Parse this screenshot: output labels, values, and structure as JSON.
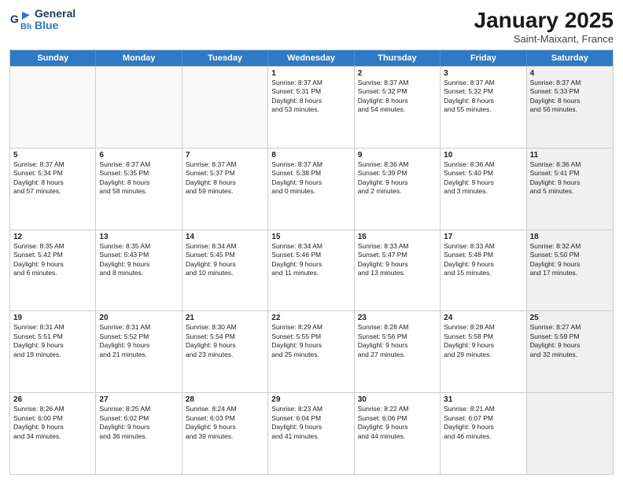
{
  "header": {
    "logo_general": "General",
    "logo_blue": "Blue",
    "month_title": "January 2025",
    "location": "Saint-Maixant, France"
  },
  "weekdays": [
    "Sunday",
    "Monday",
    "Tuesday",
    "Wednesday",
    "Thursday",
    "Friday",
    "Saturday"
  ],
  "rows": [
    [
      {
        "day": "",
        "text": "",
        "empty": true
      },
      {
        "day": "",
        "text": "",
        "empty": true
      },
      {
        "day": "",
        "text": "",
        "empty": true
      },
      {
        "day": "1",
        "text": "Sunrise: 8:37 AM\nSunset: 5:31 PM\nDaylight: 8 hours\nand 53 minutes."
      },
      {
        "day": "2",
        "text": "Sunrise: 8:37 AM\nSunset: 5:32 PM\nDaylight: 8 hours\nand 54 minutes."
      },
      {
        "day": "3",
        "text": "Sunrise: 8:37 AM\nSunset: 5:32 PM\nDaylight: 8 hours\nand 55 minutes."
      },
      {
        "day": "4",
        "text": "Sunrise: 8:37 AM\nSunset: 5:33 PM\nDaylight: 8 hours\nand 56 minutes.",
        "shaded": true
      }
    ],
    [
      {
        "day": "5",
        "text": "Sunrise: 8:37 AM\nSunset: 5:34 PM\nDaylight: 8 hours\nand 57 minutes."
      },
      {
        "day": "6",
        "text": "Sunrise: 8:37 AM\nSunset: 5:35 PM\nDaylight: 8 hours\nand 58 minutes."
      },
      {
        "day": "7",
        "text": "Sunrise: 8:37 AM\nSunset: 5:37 PM\nDaylight: 8 hours\nand 59 minutes."
      },
      {
        "day": "8",
        "text": "Sunrise: 8:37 AM\nSunset: 5:38 PM\nDaylight: 9 hours\nand 0 minutes."
      },
      {
        "day": "9",
        "text": "Sunrise: 8:36 AM\nSunset: 5:39 PM\nDaylight: 9 hours\nand 2 minutes."
      },
      {
        "day": "10",
        "text": "Sunrise: 8:36 AM\nSunset: 5:40 PM\nDaylight: 9 hours\nand 3 minutes."
      },
      {
        "day": "11",
        "text": "Sunrise: 8:36 AM\nSunset: 5:41 PM\nDaylight: 9 hours\nand 5 minutes.",
        "shaded": true
      }
    ],
    [
      {
        "day": "12",
        "text": "Sunrise: 8:35 AM\nSunset: 5:42 PM\nDaylight: 9 hours\nand 6 minutes."
      },
      {
        "day": "13",
        "text": "Sunrise: 8:35 AM\nSunset: 5:43 PM\nDaylight: 9 hours\nand 8 minutes."
      },
      {
        "day": "14",
        "text": "Sunrise: 8:34 AM\nSunset: 5:45 PM\nDaylight: 9 hours\nand 10 minutes."
      },
      {
        "day": "15",
        "text": "Sunrise: 8:34 AM\nSunset: 5:46 PM\nDaylight: 9 hours\nand 11 minutes."
      },
      {
        "day": "16",
        "text": "Sunrise: 8:33 AM\nSunset: 5:47 PM\nDaylight: 9 hours\nand 13 minutes."
      },
      {
        "day": "17",
        "text": "Sunrise: 8:33 AM\nSunset: 5:48 PM\nDaylight: 9 hours\nand 15 minutes."
      },
      {
        "day": "18",
        "text": "Sunrise: 8:32 AM\nSunset: 5:50 PM\nDaylight: 9 hours\nand 17 minutes.",
        "shaded": true
      }
    ],
    [
      {
        "day": "19",
        "text": "Sunrise: 8:31 AM\nSunset: 5:51 PM\nDaylight: 9 hours\nand 19 minutes."
      },
      {
        "day": "20",
        "text": "Sunrise: 8:31 AM\nSunset: 5:52 PM\nDaylight: 9 hours\nand 21 minutes."
      },
      {
        "day": "21",
        "text": "Sunrise: 8:30 AM\nSunset: 5:54 PM\nDaylight: 9 hours\nand 23 minutes."
      },
      {
        "day": "22",
        "text": "Sunrise: 8:29 AM\nSunset: 5:55 PM\nDaylight: 9 hours\nand 25 minutes."
      },
      {
        "day": "23",
        "text": "Sunrise: 8:28 AM\nSunset: 5:56 PM\nDaylight: 9 hours\nand 27 minutes."
      },
      {
        "day": "24",
        "text": "Sunrise: 8:28 AM\nSunset: 5:58 PM\nDaylight: 9 hours\nand 29 minutes."
      },
      {
        "day": "25",
        "text": "Sunrise: 8:27 AM\nSunset: 5:59 PM\nDaylight: 9 hours\nand 32 minutes.",
        "shaded": true
      }
    ],
    [
      {
        "day": "26",
        "text": "Sunrise: 8:26 AM\nSunset: 6:00 PM\nDaylight: 9 hours\nand 34 minutes."
      },
      {
        "day": "27",
        "text": "Sunrise: 8:25 AM\nSunset: 6:02 PM\nDaylight: 9 hours\nand 36 minutes."
      },
      {
        "day": "28",
        "text": "Sunrise: 8:24 AM\nSunset: 6:03 PM\nDaylight: 9 hours\nand 39 minutes."
      },
      {
        "day": "29",
        "text": "Sunrise: 8:23 AM\nSunset: 6:04 PM\nDaylight: 9 hours\nand 41 minutes."
      },
      {
        "day": "30",
        "text": "Sunrise: 8:22 AM\nSunset: 6:06 PM\nDaylight: 9 hours\nand 44 minutes."
      },
      {
        "day": "31",
        "text": "Sunrise: 8:21 AM\nSunset: 6:07 PM\nDaylight: 9 hours\nand 46 minutes."
      },
      {
        "day": "",
        "text": "",
        "empty": true,
        "shaded": true
      }
    ]
  ]
}
